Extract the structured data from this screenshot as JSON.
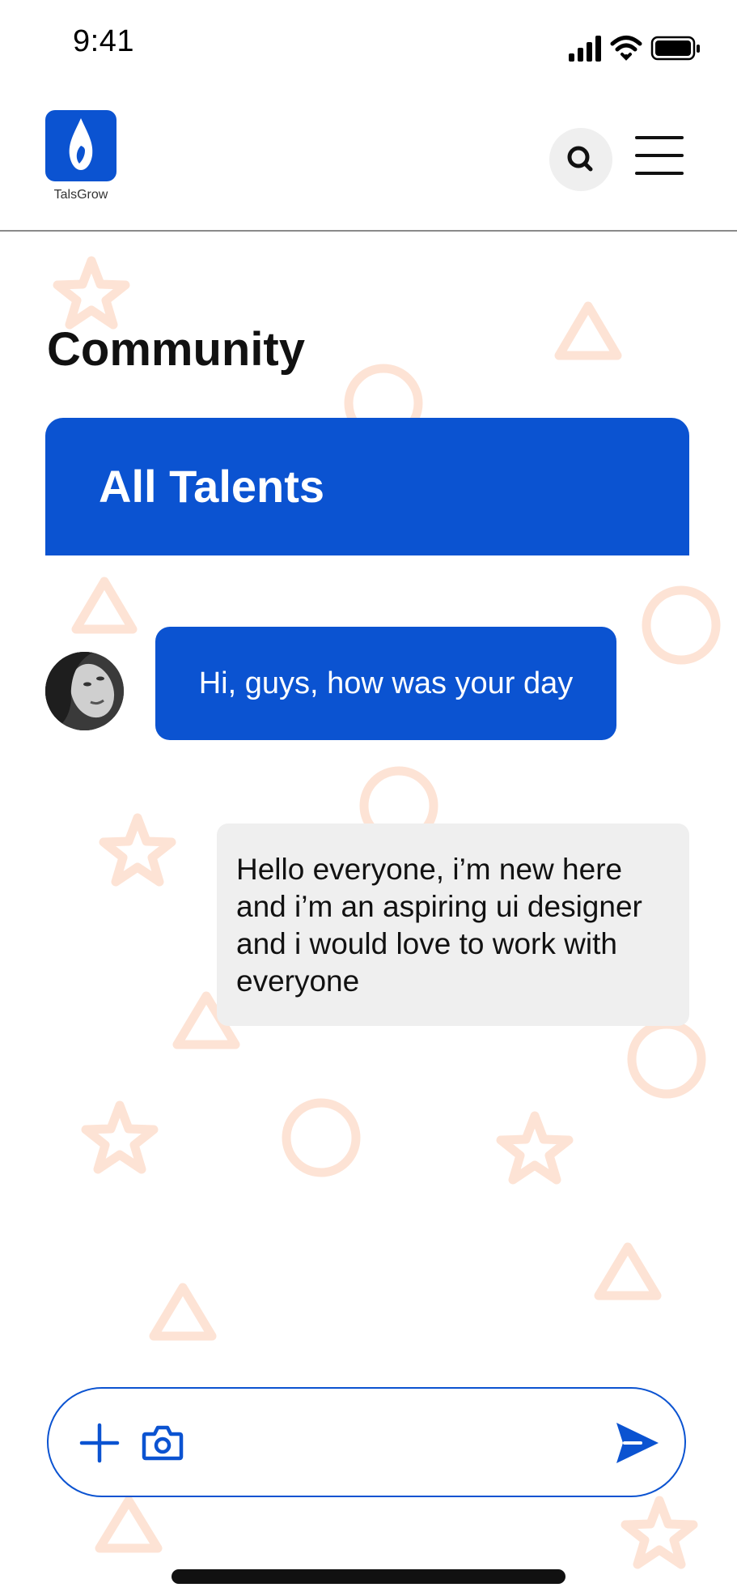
{
  "status_bar": {
    "time": "9:41"
  },
  "header": {
    "logo_text": "TalsGrow"
  },
  "page": {
    "title": "Community"
  },
  "channel": {
    "label": "All Talents"
  },
  "messages": [
    {
      "sender": "other",
      "text": "Hi, guys, how was your day"
    },
    {
      "sender": "me",
      "lines": [
        "Hello everyone, i’m new here",
        "and i’m an aspiring ui designer",
        "and i would love to work with",
        "everyone"
      ]
    }
  ],
  "composer": {
    "placeholder": ""
  },
  "icons": {
    "logo": "talsgrow-logo-icon",
    "search": "search-icon",
    "menu": "hamburger-menu-icon",
    "attach": "plus-icon",
    "camera": "camera-icon",
    "send": "send-icon"
  },
  "colors": {
    "primary": "#0b53d1",
    "bubble_out_bg": "#efefef",
    "decor": "#fde3d5"
  }
}
